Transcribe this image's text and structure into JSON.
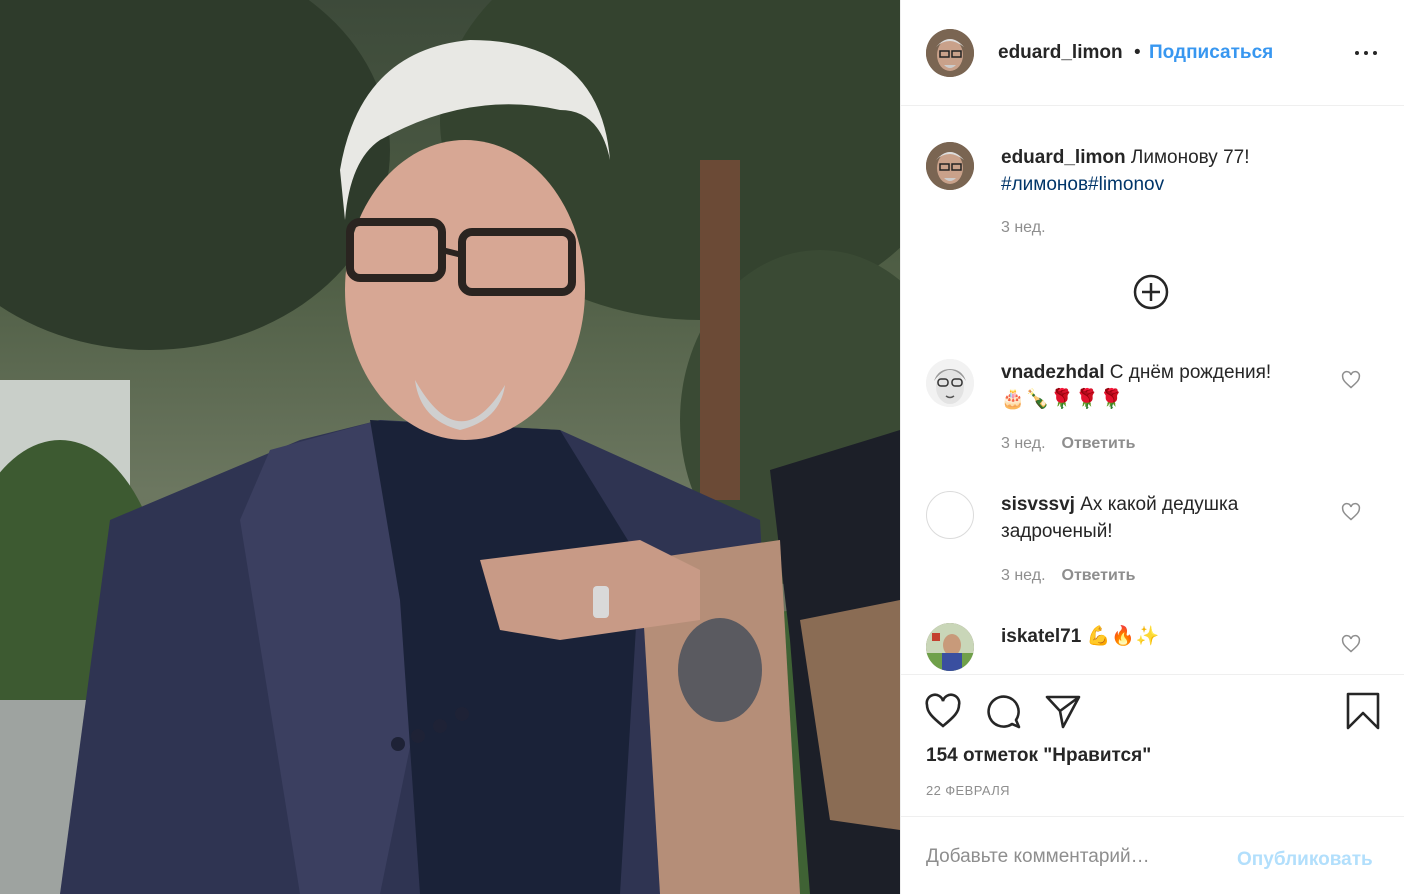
{
  "post": {
    "photo_icon": "portrait-photo",
    "author": "eduard_limon",
    "separator": "•",
    "follow_label": "Подписаться",
    "more_icon": "more-options-icon"
  },
  "caption": {
    "author": "eduard_limon",
    "text": "Лимонову 77!",
    "hashtags": "#лимонов#limonov",
    "time": "3 нед."
  },
  "load_more_icon": "plus-circle-icon",
  "comments": [
    {
      "author": "vnadezhdal",
      "text": "С днём рождения!",
      "emoji": "🎂🍾🌹🌹🌹",
      "time": "3 нед.",
      "reply_label": "Ответить"
    },
    {
      "author": "sisvssvj",
      "text": "Ах какой дедушка задроченый!",
      "time": "3 нед.",
      "reply_label": "Ответить"
    },
    {
      "author": "iskatel71",
      "emoji": "💪🔥✨"
    }
  ],
  "actions": {
    "like_icon": "heart-icon",
    "comment_icon": "comment-icon",
    "share_icon": "share-icon",
    "save_icon": "bookmark-icon"
  },
  "likes_text": "154 отметок \"Нравится\"",
  "date": "22 февраля",
  "composer": {
    "placeholder": "Добавьте комментарий…",
    "publish_label": "Опубликовать"
  },
  "colors": {
    "link": "#3897f0",
    "hashtag": "#003569",
    "muted": "#8e8e8e",
    "publish_disabled": "#b2dffc"
  }
}
